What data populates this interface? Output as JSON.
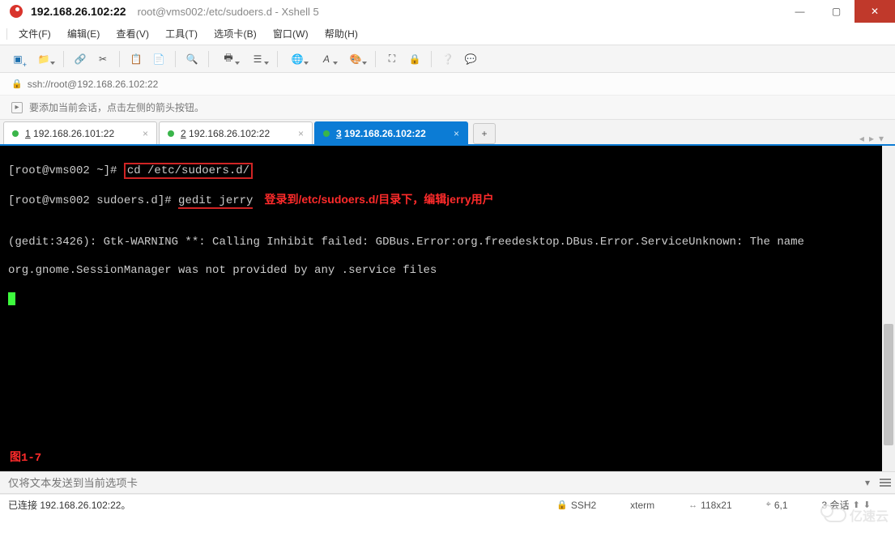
{
  "titlebar": {
    "ip": "192.168.26.102:22",
    "path": "root@vms002:/etc/sudoers.d - Xshell 5"
  },
  "menu": {
    "file": "文件(F)",
    "edit": "编辑(E)",
    "view": "查看(V)",
    "tool": "工具(T)",
    "tab": "选项卡(B)",
    "window": "窗口(W)",
    "help": "帮助(H)"
  },
  "address": {
    "url": "ssh://root@192.168.26.102:22"
  },
  "tip": {
    "text": "要添加当前会话，点击左侧的箭头按钮。"
  },
  "tabs": {
    "t1_pre": "1",
    "t1_rest": " 192.168.26.101:22",
    "t2_pre": "2",
    "t2_rest": " 192.168.26.102:22",
    "t3_pre": "3",
    "t3_rest": " 192.168.26.102:22",
    "add": "+"
  },
  "term": {
    "p1a": "[root@vms002 ~]# ",
    "p1b": "cd /etc/sudoers.d/",
    "p2a": "[root@vms002 sudoers.d]# ",
    "p2b": "gedit jerry",
    "anno": "登录到/etc/sudoers.d/目录下，编辑jerry用户",
    "blank": "",
    "err1": "(gedit:3426): Gtk-WARNING **: Calling Inhibit failed: GDBus.Error:org.freedesktop.DBus.Error.ServiceUnknown: The name",
    "err2": "org.gnome.SessionManager was not provided by any .service files",
    "fig": "图1-7"
  },
  "send": {
    "placeholder": "仅将文本发送到当前选项卡"
  },
  "status": {
    "conn": "已连接 192.168.26.102:22。",
    "ssh": "SSH2",
    "term": "xterm",
    "size": "118x21",
    "pos": "6,1",
    "sess": "3 会话"
  },
  "watermark": "亿速云"
}
